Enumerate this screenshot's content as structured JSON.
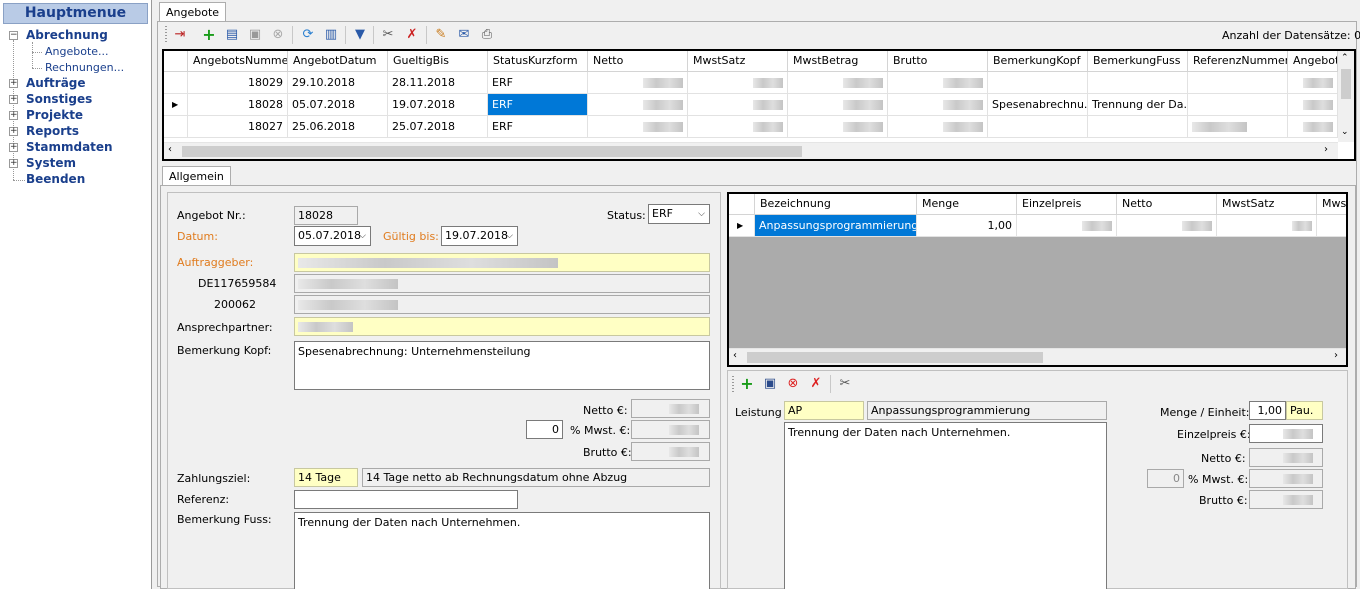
{
  "menu": {
    "title": "Hauptmenue",
    "items": [
      {
        "label": "Abrechnung",
        "box": "−"
      },
      {
        "label": "Aufträge",
        "box": "+"
      },
      {
        "label": "Sonstiges",
        "box": "+"
      },
      {
        "label": "Projekte",
        "box": "+"
      },
      {
        "label": "Reports",
        "box": "+"
      },
      {
        "label": "Stammdaten",
        "box": "+"
      },
      {
        "label": "System",
        "box": "+"
      },
      {
        "label": "Beenden",
        "box": ""
      }
    ],
    "subitems": [
      "Angebote...",
      "Rechnungen..."
    ]
  },
  "main_tab": "Angebote",
  "record_count": "Anzahl der Datensätze: 0",
  "grid": {
    "headers": [
      "AngebotsNummer",
      "AngebotDatum",
      "GueltigBis",
      "StatusKurzform",
      "Netto",
      "MwstSatz",
      "MwstBetrag",
      "Brutto",
      "BemerkungKopf",
      "BemerkungFuss",
      "ReferenzNummer",
      "Angebots"
    ],
    "rows": [
      {
        "nr": "18029",
        "datum": "29.10.2018",
        "bis": "28.11.2018",
        "status": "ERF",
        "kopf": "",
        "fuss": ""
      },
      {
        "nr": "18028",
        "datum": "05.07.2018",
        "bis": "19.07.2018",
        "status": "ERF",
        "kopf": "Spesenabrechnu...",
        "fuss": "Trennung der Da..."
      },
      {
        "nr": "18027",
        "datum": "25.06.2018",
        "bis": "25.07.2018",
        "status": "ERF",
        "kopf": "",
        "fuss": ""
      }
    ]
  },
  "detail_tab": "Allgemein",
  "form": {
    "angebot_nr_label": "Angebot Nr.:",
    "angebot_nr": "18028",
    "status_label": "Status:",
    "status": "ERF",
    "datum_label": "Datum:",
    "datum": "05.07.2018",
    "gueltig_label": "Gültig bis:",
    "gueltig": "19.07.2018",
    "auftraggeber_label": "Auftraggeber:",
    "ust_id": "DE117659584",
    "kunden_nr": "200062",
    "ansprech_label": "Ansprechpartner:",
    "bem_kopf_label": "Bemerkung Kopf:",
    "bem_kopf": "Spesenabrechnung: Unternehmensteilung",
    "netto_label": "Netto €:",
    "mwst_label": "% Mwst. €:",
    "mwst_pct": "0",
    "brutto_label": "Brutto €:",
    "zahlungsziel_label": "Zahlungsziel:",
    "zahlungsziel": "14 Tage",
    "zahlungsziel_text": "14 Tage netto ab Rechnungsdatum ohne Abzug",
    "referenz_label": "Referenz:",
    "referenz": "",
    "bem_fuss_label": "Bemerkung Fuss:",
    "bem_fuss": "Trennung der Daten nach Unternehmen."
  },
  "pos_grid": {
    "headers": [
      "Bezeichnung",
      "Menge",
      "Einzelpreis",
      "Netto",
      "MwstSatz",
      "Mwst"
    ],
    "rows": [
      {
        "bez": "Anpassungsprogrammierung",
        "menge": "1,00"
      }
    ]
  },
  "pos_form": {
    "leistung_label": "Leistung",
    "leistung_code": "AP",
    "leistung_name": "Anpassungsprogrammierung",
    "text": "Trennung der Daten nach Unternehmen.",
    "menge_label": "Menge / Einheit:",
    "menge": "1,00",
    "einheit": "Pau.",
    "einzelpreis_label": "Einzelpreis €:",
    "netto_label": "Netto €:",
    "mwst_label": "% Mwst. €:",
    "mwst_pct": "0",
    "brutto_label": "Brutto €:"
  }
}
